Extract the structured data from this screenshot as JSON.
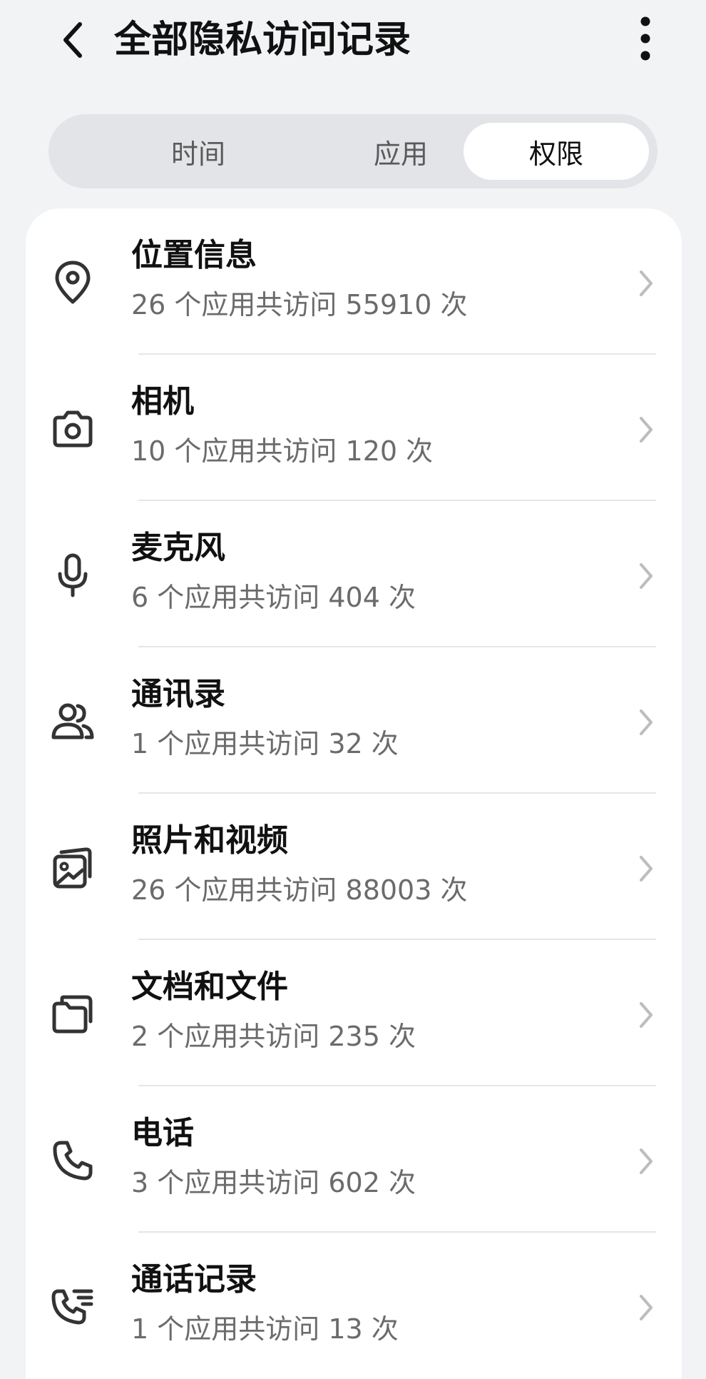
{
  "header": {
    "title": "全部隐私访问记录",
    "back_icon": "back-arrow-icon",
    "more_icon": "more-vertical-icon"
  },
  "tabs": [
    {
      "label": "时间",
      "active": false
    },
    {
      "label": "应用",
      "active": false
    },
    {
      "label": "权限",
      "active": true
    }
  ],
  "permissions": [
    {
      "title": "位置信息",
      "subtitle": "26 个应用共访问 55910 次",
      "icon": "location-pin-icon"
    },
    {
      "title": "相机",
      "subtitle": "10 个应用共访问 120 次",
      "icon": "camera-icon"
    },
    {
      "title": "麦克风",
      "subtitle": "6 个应用共访问 404 次",
      "icon": "microphone-icon"
    },
    {
      "title": "通讯录",
      "subtitle": "1 个应用共访问 32 次",
      "icon": "contacts-icon"
    },
    {
      "title": "照片和视频",
      "subtitle": "26 个应用共访问 88003 次",
      "icon": "photos-icon"
    },
    {
      "title": "文档和文件",
      "subtitle": "2 个应用共访问 235 次",
      "icon": "folder-icon"
    },
    {
      "title": "电话",
      "subtitle": "3 个应用共访问 602 次",
      "icon": "phone-icon"
    },
    {
      "title": "通话记录",
      "subtitle": "1 个应用共访问 13 次",
      "icon": "call-log-icon"
    }
  ],
  "colors": {
    "background": "#f1f3f5",
    "card": "#ffffff",
    "tab_track": "#e2e4e7",
    "text_primary": "#111111",
    "text_secondary": "#6b6b6b"
  }
}
